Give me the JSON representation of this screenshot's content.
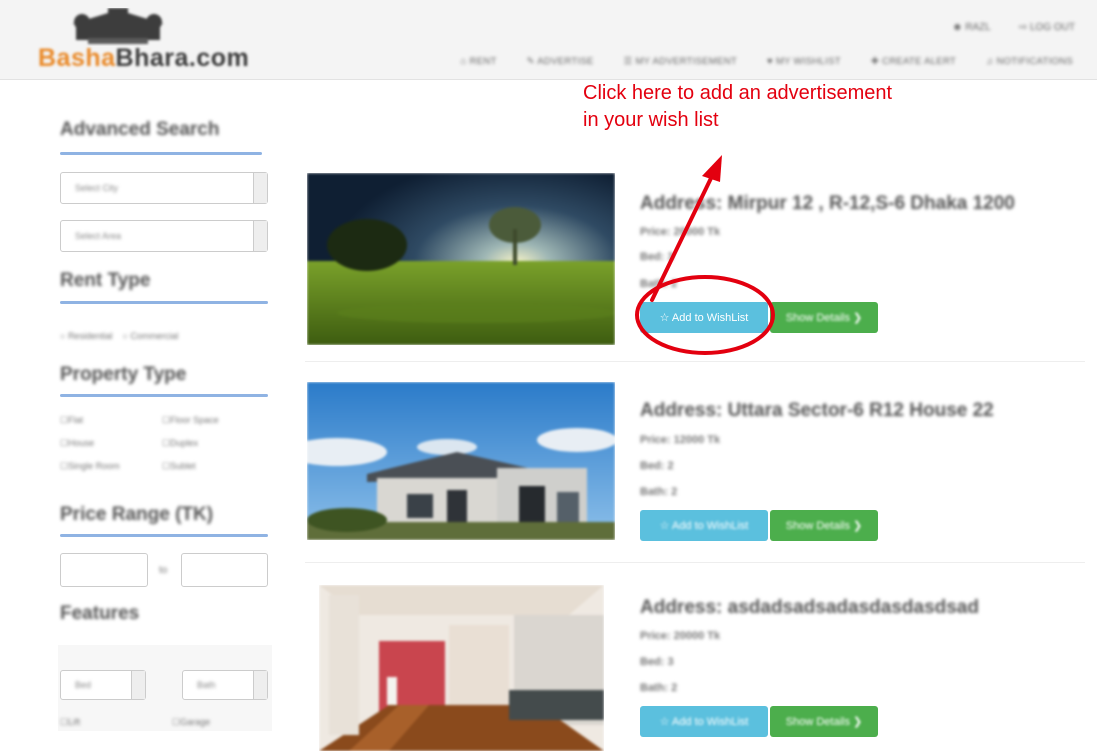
{
  "navbar": {
    "logo": {
      "part1": "Basha",
      "part2": "Bhara.com"
    },
    "top_links": [
      "RAZL",
      "LOG OUT"
    ],
    "menu": [
      "RENT",
      "ADVERTISE",
      "MY ADVERTISEMENT",
      "MY WISHLIST",
      "CREATE ALERT",
      "NOTIFICATIONS"
    ]
  },
  "sidebar": {
    "advanced_search": "Advanced Search",
    "select_city": "Select City",
    "select_area": "Select Area",
    "rent_type": "Rent Type",
    "rent_options": [
      "Residential",
      "Commercial"
    ],
    "property_type": "Property Type",
    "property_options": [
      "Flat",
      "Floor Space",
      "House",
      "Duplex",
      "Single Room",
      "Sublet"
    ],
    "price_range": "Price Range (TK)",
    "price_to": "to",
    "features": "Features",
    "bed_select": "Bed",
    "bath_select": "Bath",
    "feature_options": [
      "Lift",
      "Garage"
    ]
  },
  "listings": [
    {
      "address": "Address: Mirpur 12 , R-12,S-6 Dhaka 1200",
      "price": "Price: 20000 Tk",
      "bed": "Bed: 3",
      "bath": "Bath: 2",
      "wish_label": "☆ Add to WishList",
      "show_label": "Show Details ❯"
    },
    {
      "address": "Address: Uttara Sector-6 R12 House 22",
      "price": "Price: 12000 Tk",
      "bed": "Bed: 2",
      "bath": "Bath: 2",
      "wish_label": "☆ Add to WishList",
      "show_label": "Show Details ❯"
    },
    {
      "address": "Address: asdadsadsadasdasdasdsad",
      "price": "Price: 20000 Tk",
      "bed": "Bed: 3",
      "bath": "Bath: 2",
      "wish_label": "☆ Add to WishList",
      "show_label": "Show Details ❯"
    }
  ],
  "annotation": {
    "line1": "Click here to add an advertisement",
    "line2": "in your wish list",
    "color": "#e3000f"
  },
  "icons": [
    "user-icon",
    "logout-icon",
    "home-icon",
    "pencil-icon",
    "list-icon",
    "heart-icon",
    "bell-icon",
    "star-icon",
    "chevron-right-icon"
  ]
}
